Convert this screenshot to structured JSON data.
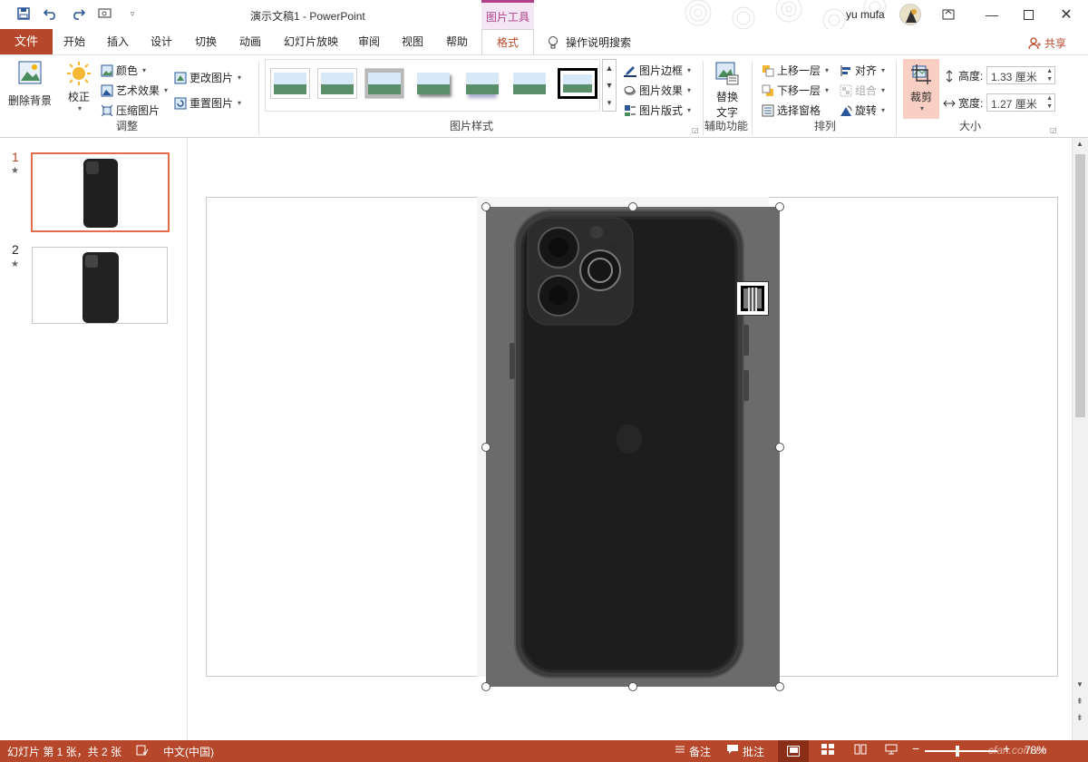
{
  "titlebar": {
    "doc_title": "演示文稿1  -  PowerPoint",
    "context_tab": "图片工具",
    "user": "yu mufa"
  },
  "tabs": {
    "file": "文件",
    "items": [
      "开始",
      "插入",
      "设计",
      "切换",
      "动画",
      "幻灯片放映",
      "审阅",
      "视图",
      "帮助"
    ],
    "active": "格式",
    "tell_me": "操作说明搜索",
    "share": "共享"
  },
  "ribbon": {
    "adjust": {
      "remove_bg": "删除背景",
      "correct": "校正",
      "color": "颜色",
      "artistic": "艺术效果",
      "compress": "压缩图片",
      "change": "更改图片",
      "reset": "重置图片",
      "label": "调整"
    },
    "styles": {
      "border": "图片边框",
      "effects": "图片效果",
      "layout": "图片版式",
      "label": "图片样式"
    },
    "access": {
      "alt_text_line1": "替换",
      "alt_text_line2": "文字",
      "label": "辅助功能"
    },
    "arrange": {
      "forward": "上移一层",
      "backward": "下移一层",
      "selection": "选择窗格",
      "align": "对齐",
      "group": "组合",
      "rotate": "旋转",
      "label": "排列"
    },
    "size": {
      "crop": "裁剪",
      "height_label": "高度:",
      "height_value": "1.33 厘米",
      "width_label": "宽度:",
      "width_value": "1.27 厘米",
      "label": "大小"
    }
  },
  "slides": [
    {
      "num": "1",
      "star": "★"
    },
    {
      "num": "2",
      "star": "★"
    }
  ],
  "status": {
    "slide_info": "幻灯片 第 1 张，共 2 张",
    "language": "中文(中国)",
    "notes": "备注",
    "comments": "批注",
    "zoom": "78%",
    "watermark": "cfan.com.cn"
  },
  "colors": {
    "accent": "#b7472a",
    "context": "#b0438a"
  }
}
